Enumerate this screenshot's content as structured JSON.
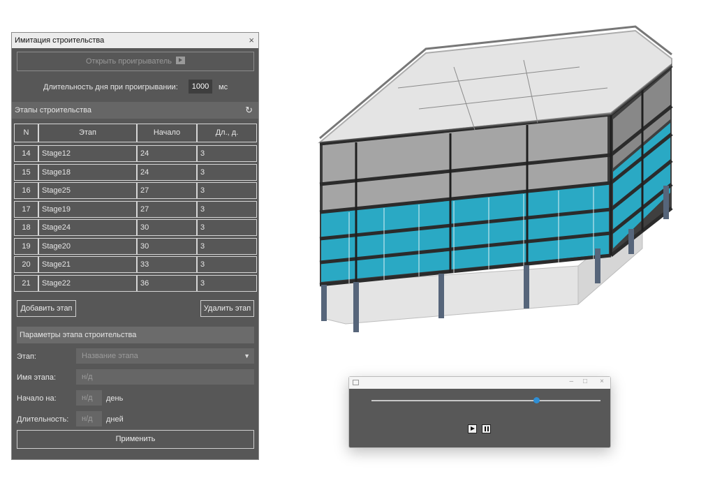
{
  "panel": {
    "title": "Имитация строительства",
    "close_glyph": "×",
    "open_player_label": "Открыть проигрыватель",
    "day_duration_label": "Длительность дня при проигрывании:",
    "day_duration_value": "1000",
    "day_duration_unit": "мс",
    "stages_section_title": "Этапы строительства",
    "refresh_glyph": "↻",
    "table": {
      "headers": [
        "N",
        "Этап",
        "Начало",
        "Дл., д."
      ],
      "rows": [
        [
          "14",
          "Stage12",
          "24",
          "3"
        ],
        [
          "15",
          "Stage18",
          "24",
          "3"
        ],
        [
          "16",
          "Stage25",
          "27",
          "3"
        ],
        [
          "17",
          "Stage19",
          "27",
          "3"
        ],
        [
          "18",
          "Stage24",
          "30",
          "3"
        ],
        [
          "19",
          "Stage20",
          "30",
          "3"
        ],
        [
          "20",
          "Stage21",
          "33",
          "3"
        ],
        [
          "21",
          "Stage22",
          "36",
          "3"
        ]
      ]
    },
    "add_stage_label": "Добавить этап",
    "delete_stage_label": "Удалить этап",
    "params_section_title": "Параметры этапа строительства",
    "stage_label": "Этап:",
    "stage_placeholder": "Название этапа",
    "name_label": "Имя этапа:",
    "name_value": "н/д",
    "start_label": "Начало на:",
    "start_value": "н/д",
    "start_unit": "день",
    "duration_label": "Длительность:",
    "duration_value": "н/д",
    "duration_unit": "дней",
    "apply_label": "Применить"
  },
  "player": {
    "minimize_glyph": "–",
    "maximize_glyph": "□",
    "close_glyph": "×",
    "progress": 0.72
  },
  "colors": {
    "panel_bg": "#575757",
    "glass": "#2aa9c4",
    "slider_thumb": "#2e8fd6"
  }
}
